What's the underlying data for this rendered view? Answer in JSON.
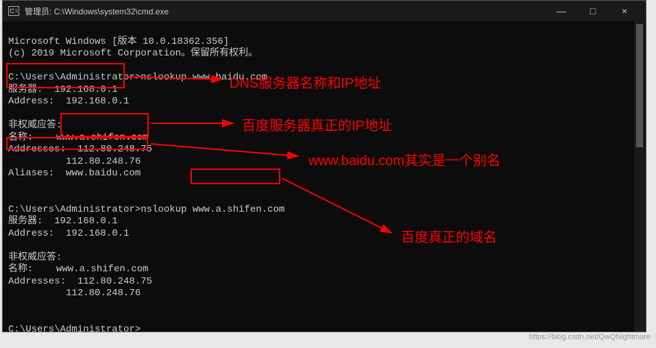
{
  "titlebar": {
    "icon_label": "C:\\",
    "title": "管理员: C:\\Windows\\system32\\cmd.exe",
    "minimize": "—",
    "maximize": "□",
    "close": "×"
  },
  "terminal": {
    "line1": "Microsoft Windows [版本 10.0.18362.356]",
    "line2": "(c) 2019 Microsoft Corporation。保留所有权利。",
    "blank1": "",
    "prompt1": "C:\\Users\\Administrator>nslookup www.baidu.com",
    "server1_label": "服务器:  192.168.0.1",
    "address1": "Address:  192.168.0.1",
    "blank2": "",
    "nonauth1": "非权威应答:",
    "name1": "名称:    www.a.shifen.com",
    "addresses1a": "Addresses:  112.80.248.75",
    "addresses1b": "          112.80.248.76",
    "aliases1": "Aliases:  www.baidu.com",
    "blank3": "",
    "blank4": "",
    "prompt2": "C:\\Users\\Administrator>nslookup www.a.shifen.com",
    "server2_label": "服务器:  192.168.0.1",
    "address2": "Address:  192.168.0.1",
    "blank5": "",
    "nonauth2": "非权威应答:",
    "name2": "名称:    www.a.shifen.com",
    "addresses2a": "Addresses:  112.80.248.75",
    "addresses2b": "          112.80.248.76",
    "blank6": "",
    "blank7": "",
    "prompt3": "C:\\Users\\Administrator>"
  },
  "annotations": {
    "a1": "DNS服务器名称和IP地址",
    "a2": "百度服务器真正的IP地址",
    "a3": "www.baidu.com其实是一个别名",
    "a4": "百度真正的域名"
  },
  "watermark": "https://blog.csdn.net/QwQNightmare"
}
